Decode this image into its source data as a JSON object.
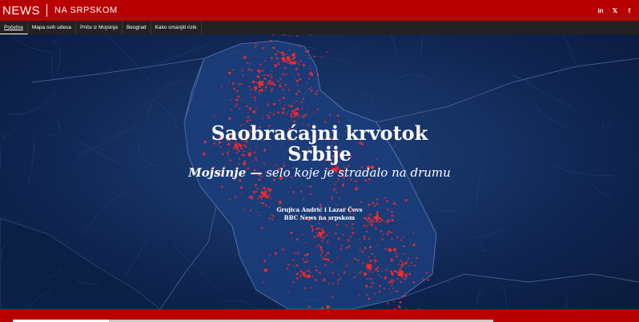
{
  "brand": {
    "name": "NEWS",
    "subtitle": "NA SRPSKOM"
  },
  "social": [
    {
      "icon": "linkedin-icon",
      "glyph": "in"
    },
    {
      "icon": "x-icon",
      "glyph": "𝕏"
    },
    {
      "icon": "facebook-icon",
      "glyph": "f"
    }
  ],
  "nav": {
    "items": [
      {
        "label": "Početna",
        "active": true
      },
      {
        "label": "Mapa svih udesa",
        "active": false
      },
      {
        "label": "Priče iz Mojsinja",
        "active": false
      },
      {
        "label": "Beograd",
        "active": false
      },
      {
        "label": "Kako smanjiti rizik",
        "active": false
      }
    ]
  },
  "hero": {
    "title_line1": "Saobraćajni krvotok",
    "title_line2": "Srbije",
    "subtitle_strong": "Mojsinje —",
    "subtitle_rest": " selo koje je stradalo na drumu",
    "byline_authors": "Grujica Andrić i Lazar Čovs",
    "byline_org": "BBC News na srpskom"
  },
  "progress": {
    "fraction": 0.2
  },
  "colors": {
    "brand_red": "#b80000",
    "nav_bg": "#222222",
    "map_bg": "#163264",
    "accident_red": "#ff2a2a"
  }
}
